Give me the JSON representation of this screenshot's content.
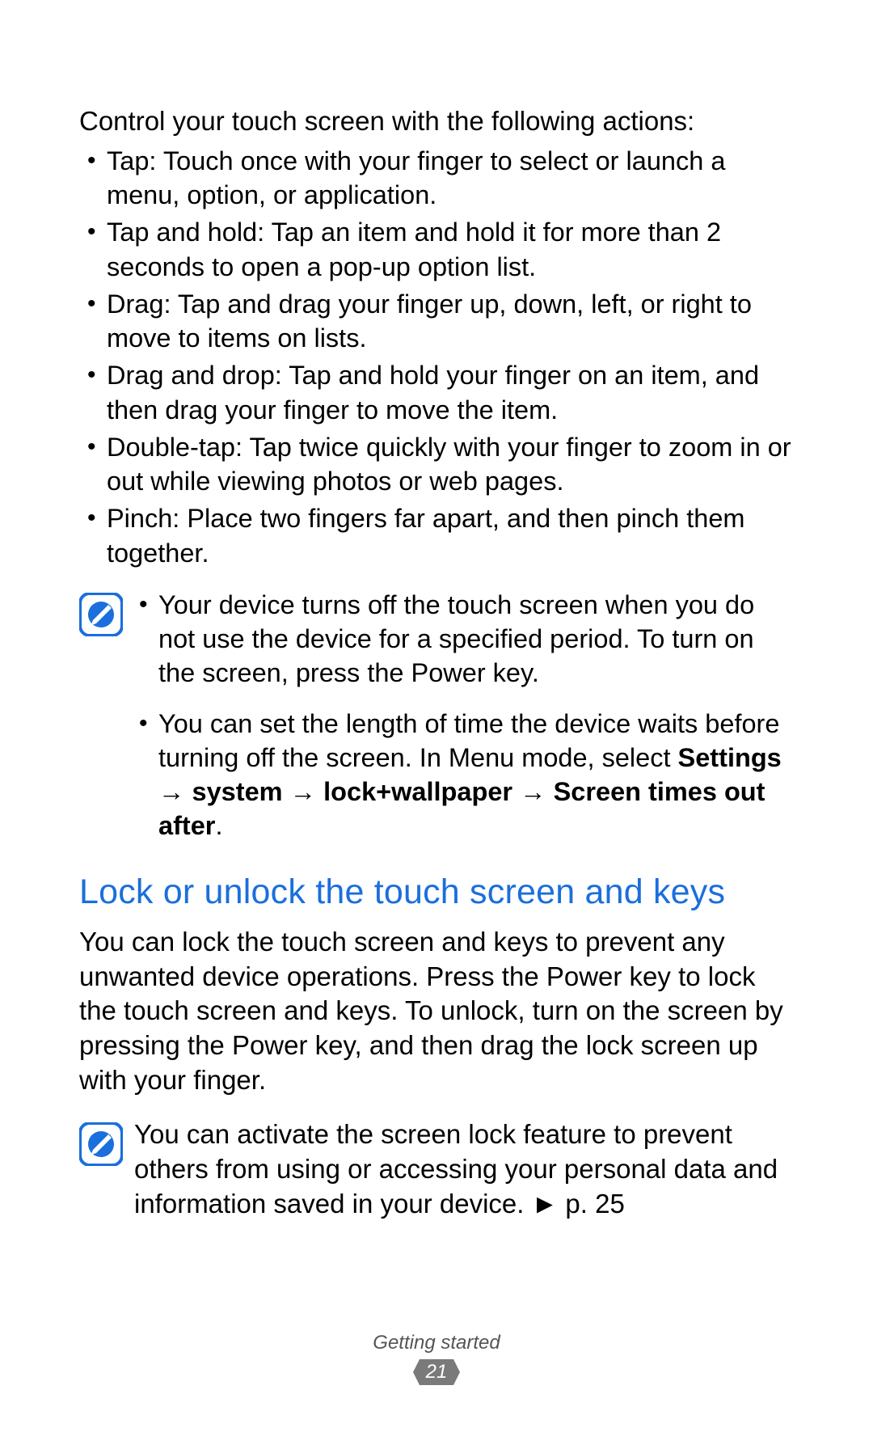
{
  "intro": "Control your touch screen with the following actions:",
  "actions": [
    "Tap: Touch once with your finger to select or launch a menu, option, or application.",
    "Tap and hold: Tap an item and hold it for more than 2 seconds to open a pop-up option list.",
    "Drag: Tap and drag your finger up, down, left, or right to move to items on lists.",
    "Drag and drop: Tap and hold your finger on an item, and then drag your finger to move the item.",
    "Double-tap: Tap twice quickly with your finger to zoom in or out while viewing photos or web pages.",
    "Pinch: Place two fingers far apart, and then pinch them together."
  ],
  "note1": {
    "item1": "Your device turns off the touch screen when you do not use the device for a specified period. To turn on the screen, press the Power key.",
    "item2_pre": "You can set the length of time the device waits before turning off the screen. In Menu mode, select ",
    "item2_bold": "Settings → system → lock+wallpaper → Screen times out after",
    "item2_post": "."
  },
  "heading": "Lock or unlock the touch screen and keys",
  "para1": "You can lock the touch screen and keys to prevent any unwanted device operations. Press the Power key to lock the touch screen and keys. To unlock, turn on the screen by pressing the Power key, and then drag the lock screen up with your finger.",
  "note2": "You can activate the screen lock feature to prevent others from using or accessing your personal data and information saved in your device. ► p. 25",
  "footer": {
    "section": "Getting started",
    "page": "21"
  }
}
